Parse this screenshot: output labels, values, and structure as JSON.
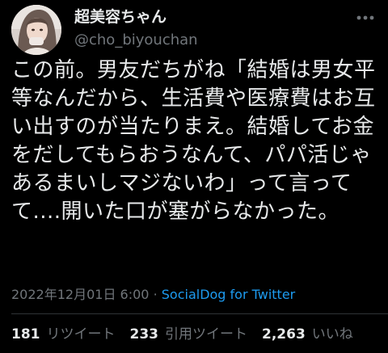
{
  "user": {
    "display_name": "超美容ちゃん",
    "handle": "@cho_biyouchan",
    "avatar": "avatar-photo"
  },
  "tweet": {
    "text": "この前。男友だちがね「結婚は男女平等なんだから、生活費や医療費はお互い出すのが当たりまえ。結婚してお金をだしてもらおうなんて、パパ活じゃあるまいしマジないわ」って言ってて....開いた口が塞がらなかった。",
    "timestamp": "2022年12月01日 6:00",
    "separator": "·",
    "source": "SocialDog for Twitter"
  },
  "stats": {
    "retweets_count": "181",
    "retweets_label": "リツイート",
    "quotes_count": "233",
    "quotes_label": "引用ツイート",
    "likes_count": "2,263",
    "likes_label": "いいね"
  },
  "icons": {
    "more": "more-horizontal-icon"
  },
  "colors": {
    "background": "#000000",
    "text": "#e7e9ea",
    "secondary": "#71767b",
    "link": "#1d9bf0",
    "divider": "#2f3336"
  }
}
